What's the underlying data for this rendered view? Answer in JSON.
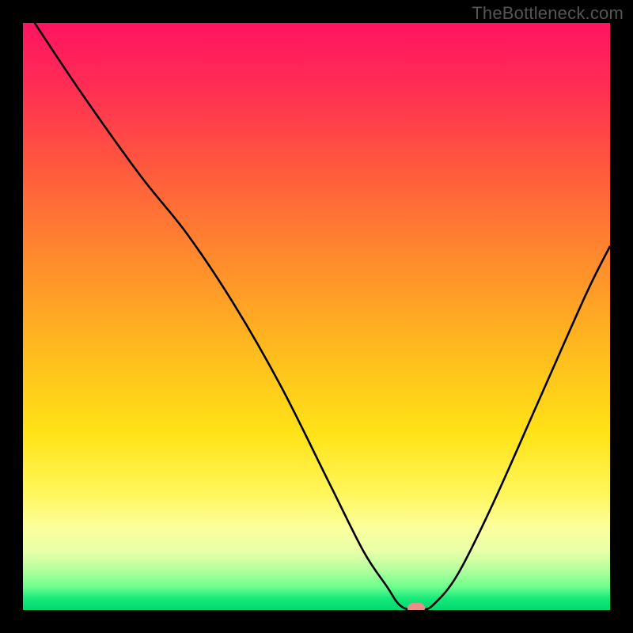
{
  "watermark": "TheBottleneck.com",
  "chart_data": {
    "type": "line",
    "title": "",
    "xlabel": "",
    "ylabel": "",
    "xlim": [
      0,
      100
    ],
    "ylim": [
      0,
      100
    ],
    "grid": false,
    "legend": false,
    "series": [
      {
        "name": "bottleneck-curve",
        "x": [
          2,
          10,
          20,
          28,
          36,
          44,
          52,
          58,
          62,
          64,
          66,
          68,
          70,
          74,
          80,
          88,
          96,
          100
        ],
        "values": [
          100,
          88,
          74,
          64,
          52,
          38,
          22,
          10,
          4,
          1,
          0,
          0,
          1,
          6,
          18,
          36,
          54,
          62
        ]
      }
    ],
    "marker": {
      "x": 67,
      "y": 0
    },
    "gradient_stops": [
      {
        "pos": 0,
        "color": "#ff1462"
      },
      {
        "pos": 10,
        "color": "#ff2b55"
      },
      {
        "pos": 25,
        "color": "#ff5a3d"
      },
      {
        "pos": 40,
        "color": "#ff8a2d"
      },
      {
        "pos": 55,
        "color": "#ffb81f"
      },
      {
        "pos": 70,
        "color": "#ffe317"
      },
      {
        "pos": 80,
        "color": "#fff65a"
      },
      {
        "pos": 86,
        "color": "#fbff9c"
      },
      {
        "pos": 90,
        "color": "#e8ffa8"
      },
      {
        "pos": 93,
        "color": "#b6ff9e"
      },
      {
        "pos": 96,
        "color": "#6fff8e"
      },
      {
        "pos": 98,
        "color": "#17e97a"
      },
      {
        "pos": 100,
        "color": "#00d870"
      }
    ]
  }
}
